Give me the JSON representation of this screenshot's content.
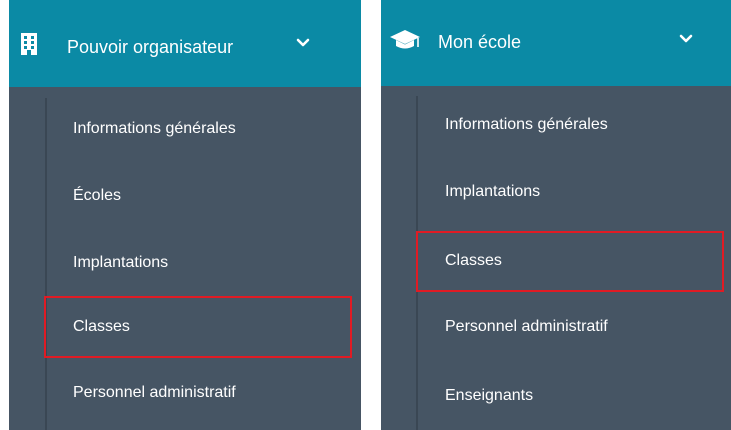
{
  "left_panel": {
    "header": {
      "label": "Pouvoir organisateur",
      "icon": "building-icon",
      "chevron": "chevron-down-icon"
    },
    "items": [
      {
        "label": "Informations générales"
      },
      {
        "label": "Écoles"
      },
      {
        "label": "Implantations"
      },
      {
        "label": "Classes",
        "highlighted": true
      },
      {
        "label": "Personnel administratif"
      }
    ]
  },
  "right_panel": {
    "header": {
      "label": "Mon école",
      "icon": "graduation-cap-icon",
      "chevron": "chevron-down-icon"
    },
    "items": [
      {
        "label": "Informations générales"
      },
      {
        "label": "Implantations"
      },
      {
        "label": "Classes",
        "highlighted": true
      },
      {
        "label": "Personnel administratif"
      },
      {
        "label": "Enseignants"
      }
    ]
  },
  "colors": {
    "header_bg": "#0b8aa5",
    "sidebar_bg": "#465564",
    "text": "#ffffff",
    "highlight_border": "#e01b24"
  }
}
